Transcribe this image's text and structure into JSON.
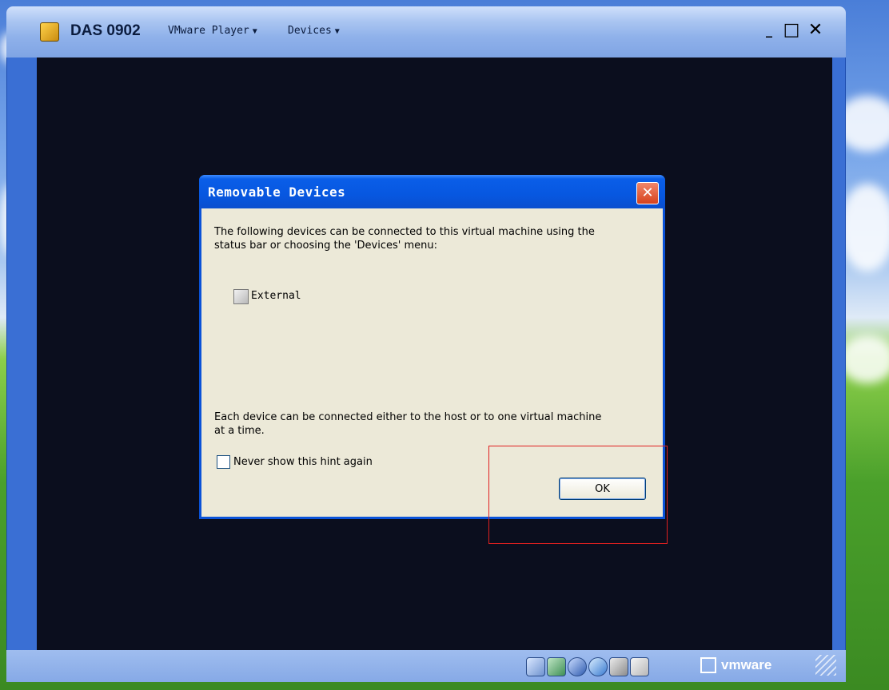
{
  "vm_window": {
    "title": "DAS 0902",
    "menus": [
      {
        "label": "VMware Player"
      },
      {
        "label": "Devices"
      }
    ],
    "controls": {
      "minimize": "_",
      "maximize": "□",
      "close": "✕"
    }
  },
  "dialog": {
    "title": "Removable Devices",
    "intro_line1": "The following devices can be connected to this virtual machine using the",
    "intro_line2": "status bar or choosing the 'Devices' menu:",
    "device_name": "External",
    "note_line1": "Each device can be connected either to the host or to one virtual machine",
    "note_line2": "at a time.",
    "checkbox_label": "Never show this hint again",
    "checkbox_checked": false,
    "ok_label": "OK"
  },
  "statusbar": {
    "device_icons": [
      "hard-disk-icon",
      "network-icon",
      "usb-icon",
      "sound-connect-icon",
      "audio-icon",
      "removable-device-icon"
    ],
    "brand": "vmware"
  },
  "colors": {
    "titlebar_blue": "#0a5ee8",
    "dialog_body": "#ece9d8",
    "highlight": "#e02020",
    "vm_screen": "#0b0e1e"
  }
}
